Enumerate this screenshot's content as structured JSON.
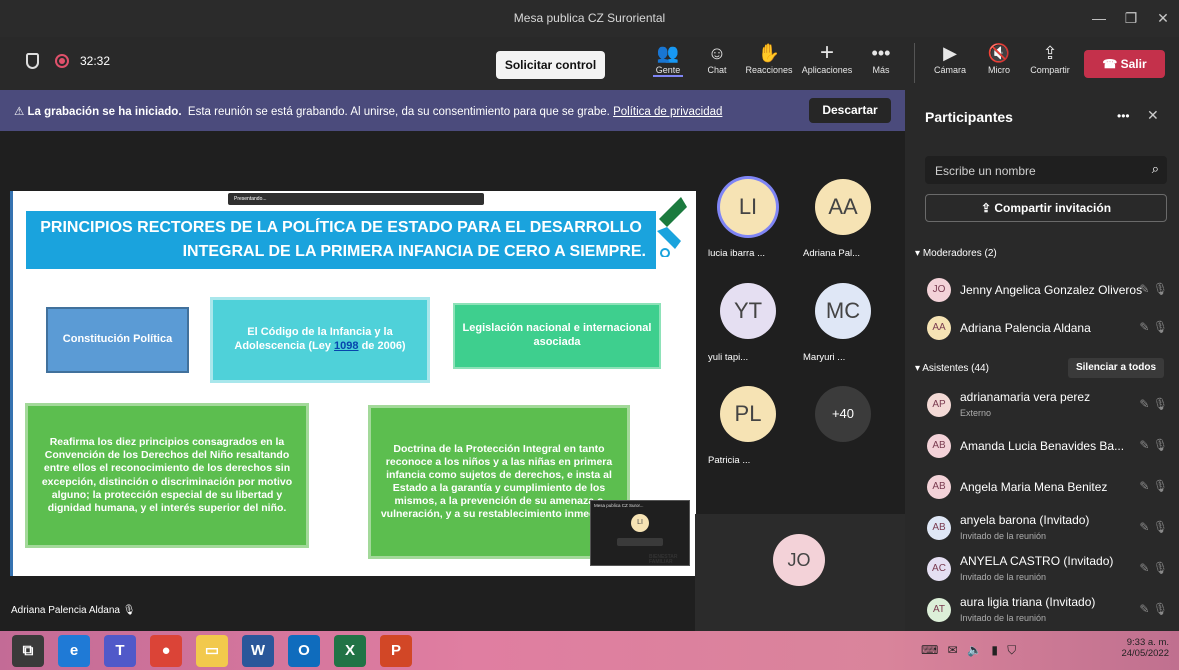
{
  "window": {
    "title": "Mesa publica CZ Suroriental"
  },
  "toolbar": {
    "timer": "32:32",
    "request_control": "Solicitar control",
    "buttons": [
      {
        "icon": "people-icon",
        "label": "Gente"
      },
      {
        "icon": "chat-icon",
        "label": "Chat"
      },
      {
        "icon": "reactions-icon",
        "label": "Reacciones"
      },
      {
        "icon": "apps-icon",
        "label": "Aplicaciones"
      },
      {
        "icon": "more-icon",
        "label": "Más"
      },
      {
        "icon": "camera-off-icon",
        "label": "Cámara"
      },
      {
        "icon": "mic-off-icon",
        "label": "Micro"
      },
      {
        "icon": "share-icon",
        "label": "Compartir"
      }
    ],
    "leave": "Salir"
  },
  "banner": {
    "bold": "La grabación se ha iniciado.",
    "text": "Esta reunión se está grabando. Al unirse, da su consentimiento para que se grabe.",
    "link": "Política de privacidad",
    "dismiss": "Descartar"
  },
  "slide": {
    "title_line1": "PRINCIPIOS RECTORES DE LA POLÍTICA DE ESTADO PARA EL DESARROLLO",
    "title_line2": "INTEGRAL DE LA PRIMERA INFANCIA DE CERO A SIEMPRE.",
    "presenting": "Presentando...",
    "box1": "Constitución Política",
    "box2_a": "El Código de la Infancia y la Adolescencia (Ley ",
    "box2_link": "1098",
    "box2_b": " de 2006)",
    "box3": "Legislación nacional e internacional asociada",
    "box4": "Reafirma los diez principios consagrados en la Convención de los Derechos del Niño resaltando entre ellos el reconocimiento de los derechos sin excepción, distinción o discriminación por motivo alguno; la protección especial de su libertad y dignidad humana, y el interés superior del niño.",
    "box5": "Doctrina de la Protección Integral en tanto reconoce a los niños y a las niñas en primera infancia como sujetos de derechos, e insta al Estado a la garantía y cumplimiento de los mismos, a la prevención de su amenaza o vulneración, y a su restablecimiento inmediato.",
    "mini_title": "Mesa publica CZ Suror...",
    "mini_avatar": "LI",
    "brand": "BIENESTAR FAMILIAR"
  },
  "tiles": [
    {
      "initials": "LI",
      "name": "lucia ibarra ...",
      "color": "#f6e3b4"
    },
    {
      "initials": "AA",
      "name": "Adriana Pal...",
      "color": "#f6e3b4"
    },
    {
      "initials": "YT",
      "name": "yuli tapi...",
      "color": "#e5dff2"
    },
    {
      "initials": "MC",
      "name": "Maryuri ...",
      "color": "#dfe7f6"
    },
    {
      "initials": "PL",
      "name": "Patricia ...",
      "color": "#f6e3b4"
    },
    {
      "initials": "+40",
      "name": "",
      "color": "#3b3b3b"
    }
  ],
  "big_tile": {
    "initials": "JO"
  },
  "speaker_label": "Adriana Palencia Aldana",
  "panel": {
    "title": "Participantes",
    "search_placeholder": "Escribe un nombre",
    "share_invite": "Compartir invitación",
    "moderators_header": "Moderadores (2)",
    "moderators": [
      {
        "initials": "JO",
        "name": "Jenny Angelica Gonzalez Oliveros",
        "sub": "",
        "color": "#f3d2d8"
      },
      {
        "initials": "AA",
        "name": "Adriana Palencia Aldana",
        "sub": "",
        "color": "#f6e3b4"
      }
    ],
    "attendees_header": "Asistentes (44)",
    "mute_all": "Silenciar a todos",
    "attendees": [
      {
        "initials": "AP",
        "name": "adrianamaria vera perez",
        "sub": "Externo",
        "color": "#f3dad6"
      },
      {
        "initials": "AB",
        "name": "Amanda Lucia Benavides Ba...",
        "sub": "",
        "color": "#f3d2d8"
      },
      {
        "initials": "AB",
        "name": "Angela Maria Mena Benitez",
        "sub": "",
        "color": "#f3d2d8"
      },
      {
        "initials": "AB",
        "name": "anyela barona (Invitado)",
        "sub": "Invitado de la reunión",
        "color": "#dfe7f6"
      },
      {
        "initials": "AC",
        "name": "ANYELA CASTRO (Invitado)",
        "sub": "Invitado de la reunión",
        "color": "#e5dff2"
      },
      {
        "initials": "AT",
        "name": "aura ligia triana (Invitado)",
        "sub": "Invitado de la reunión",
        "color": "#dcefd8"
      }
    ]
  },
  "taskbar": {
    "apps": [
      "task-view-icon",
      "edge-icon",
      "teams-icon",
      "chrome-icon",
      "explorer-icon",
      "word-icon",
      "outlook-icon",
      "excel-icon",
      "powerpoint-icon"
    ],
    "time": "9:33 a. m.",
    "date": "24/05/2022"
  }
}
